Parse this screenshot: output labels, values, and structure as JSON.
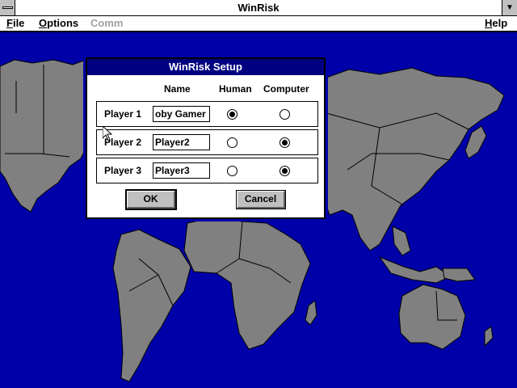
{
  "window": {
    "title": "WinRisk",
    "maximize_glyph": "▼"
  },
  "menubar": {
    "file": {
      "first": "F",
      "rest": "ile"
    },
    "options": {
      "first": "O",
      "rest": "ptions"
    },
    "comm": "Comm",
    "help": {
      "first": "H",
      "rest": "elp"
    }
  },
  "dialog": {
    "title": "WinRisk Setup",
    "headers": {
      "name": "Name",
      "human": "Human",
      "computer": "Computer"
    },
    "players": [
      {
        "label": "Player 1",
        "name": "oby Gamer",
        "human": true,
        "computer": false
      },
      {
        "label": "Player 2",
        "name": "Player2",
        "human": false,
        "computer": true
      },
      {
        "label": "Player 3",
        "name": "Player3",
        "human": false,
        "computer": true
      }
    ],
    "ok_label": "OK",
    "cancel_label": "Cancel"
  },
  "colors": {
    "ocean": "#0000a8",
    "land": "#808080",
    "dialog_title": "#000080"
  }
}
